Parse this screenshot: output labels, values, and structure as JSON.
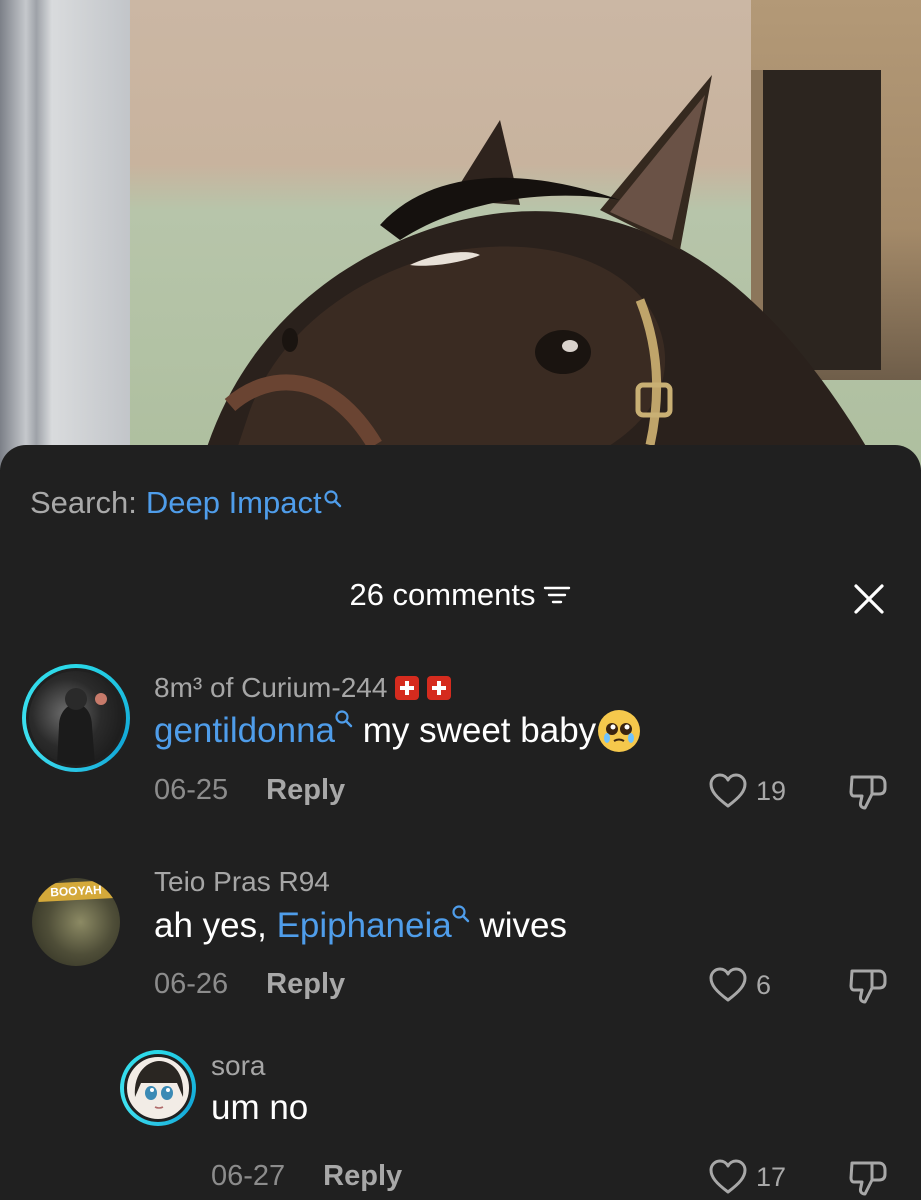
{
  "search": {
    "label": "Search:",
    "term": "Deep Impact"
  },
  "header": {
    "comment_count": "26 comments"
  },
  "icons": {
    "search": "search-icon",
    "sort": "sort-lines-icon",
    "close": "close-icon",
    "like": "heart-outline-icon",
    "dislike": "thumbs-down-icon"
  },
  "colors": {
    "accent_link": "#4f9dea",
    "sheet_bg": "#202020",
    "avatar_ring": "#29d8e8"
  },
  "comments": [
    {
      "username": "8m³ of Curium-244",
      "mention": "gentildonna",
      "text": " my sweet baby",
      "date": "06-25",
      "reply_label": "Reply",
      "likes": "19"
    },
    {
      "username": "Teio Pras R94",
      "prefix": "ah yes, ",
      "mention": "Epiphaneia",
      "text": " wives",
      "date": "06-26",
      "reply_label": "Reply",
      "likes": "6",
      "avatar_text": "BOOYAH"
    },
    {
      "username": "sora",
      "text": "um no",
      "date": "06-27",
      "reply_label": "Reply",
      "likes": "17"
    }
  ]
}
